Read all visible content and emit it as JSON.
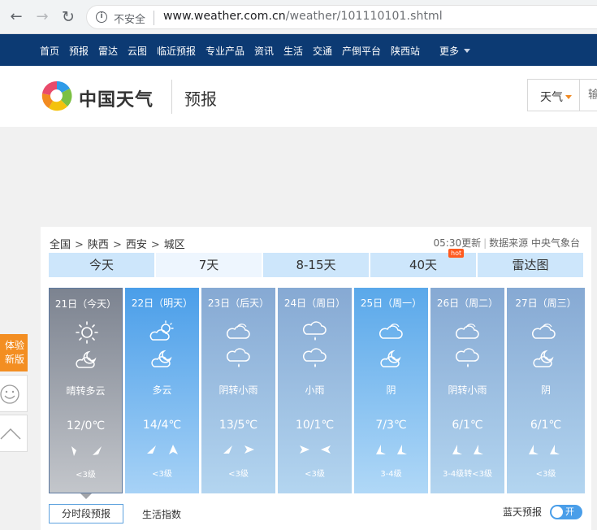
{
  "browser": {
    "insecure_label": "不安全",
    "url_host": "www.weather.com.cn",
    "url_path": "/weather/101110101.shtml"
  },
  "site_nav": [
    "首页",
    "预报",
    "雷达",
    "云图",
    "临近预报",
    "专业产品",
    "资讯",
    "生活",
    "交通",
    "产倒平台",
    "陕西站"
  ],
  "site_nav_more": "更多",
  "header": {
    "logo_text": "中国天气",
    "subtitle": "预报",
    "search_category": "天气",
    "search_placeholder": "输"
  },
  "breadcrumb": {
    "items": [
      "全国",
      "陕西",
      "西安",
      "城区"
    ],
    "separator": ">"
  },
  "update_info": {
    "time": "05:30更新",
    "source": "数据来源 中央气象台"
  },
  "tabs": [
    {
      "label": "今天"
    },
    {
      "label": "7天"
    },
    {
      "label": "8-15天"
    },
    {
      "label": "40天",
      "badge": "hot"
    },
    {
      "label": "雷达图"
    }
  ],
  "days": [
    {
      "date": "21日（今天）",
      "desc": "晴转多云",
      "temp": "12/0℃",
      "level": "<3级",
      "icon1": "sun-icon",
      "icon2": "partly-cloudy-night-icon"
    },
    {
      "date": "22日（明天）",
      "desc": "多云",
      "temp": "14/4℃",
      "level": "<3级",
      "icon1": "partly-cloudy-day-icon",
      "icon2": "partly-cloudy-night-icon"
    },
    {
      "date": "23日（后天）",
      "desc": "阴转小雨",
      "temp": "13/5℃",
      "level": "<3级",
      "icon1": "cloud-icon",
      "icon2": "rain-icon"
    },
    {
      "date": "24日（周日）",
      "desc": "小雨",
      "temp": "10/1℃",
      "level": "<3级",
      "icon1": "rain-icon",
      "icon2": "rain-icon"
    },
    {
      "date": "25日（周一）",
      "desc": "阴",
      "temp": "7/3℃",
      "level": "3-4级",
      "icon1": "cloud-icon",
      "icon2": "partly-cloudy-night-icon"
    },
    {
      "date": "26日（周二）",
      "desc": "阴转小雨",
      "temp": "6/1℃",
      "level": "3-4级转<3级",
      "icon1": "cloud-icon",
      "icon2": "rain-icon"
    },
    {
      "date": "27日（周三）",
      "desc": "阴",
      "temp": "6/1℃",
      "level": "<3级",
      "icon1": "cloud-icon",
      "icon2": "partly-cloudy-night-icon"
    }
  ],
  "bottom": {
    "hourly_label": "分时段预报",
    "life_label": "生活指数",
    "blue_sky_label": "蓝天预报",
    "toggle_label": "开"
  },
  "side": {
    "new_version": "体验新版"
  },
  "colors": {
    "nav_bg": "#0c3a73",
    "tab_bg": "#cde6fb",
    "side_orange": "#f38e22",
    "toggle_blue": "#4a9ee9"
  }
}
